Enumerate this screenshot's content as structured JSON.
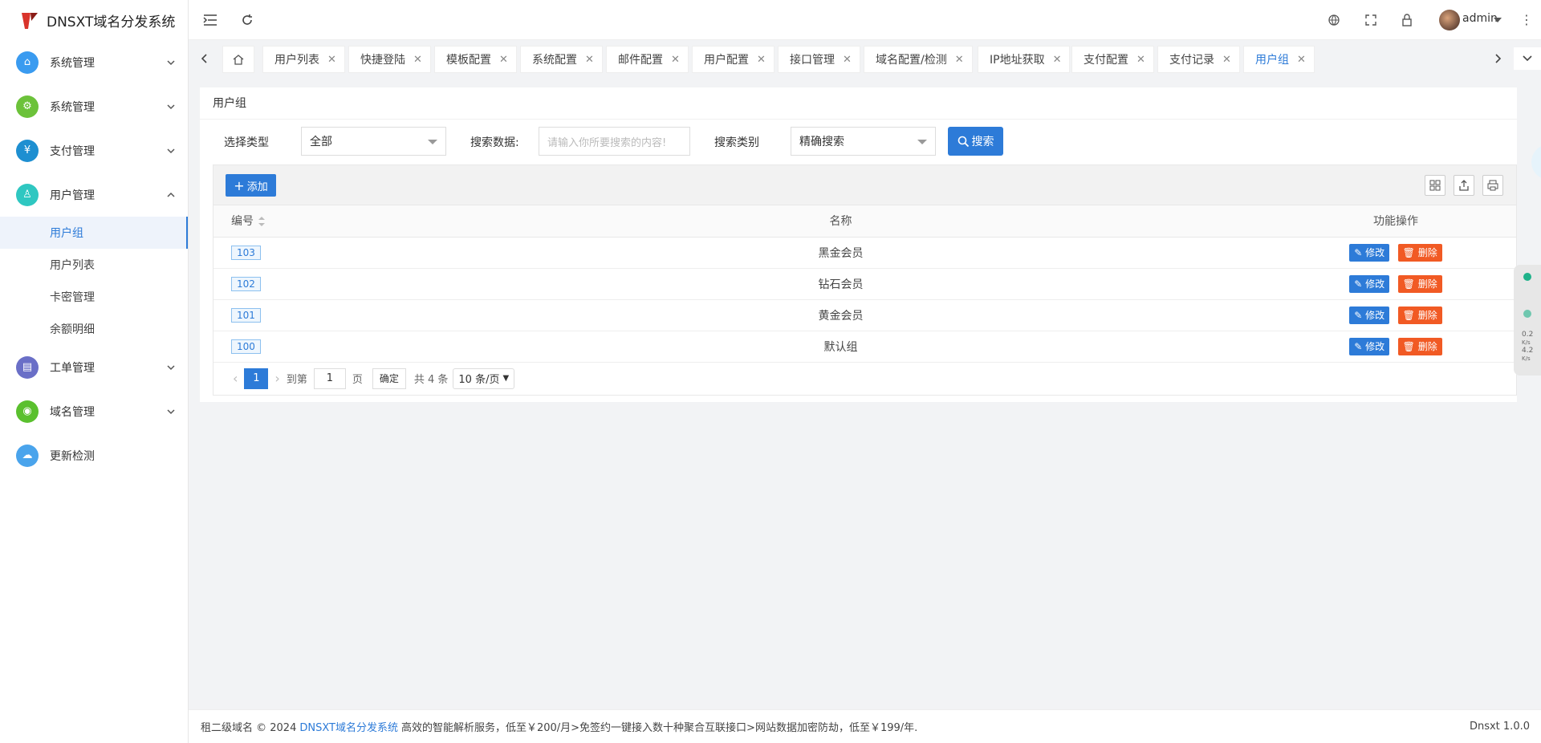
{
  "brand": {
    "title": "DNSXT域名分发系统"
  },
  "sidebar": {
    "items": [
      {
        "label": "系统管理",
        "color": "#3a9bf0",
        "icon": "home-icon"
      },
      {
        "label": "系统管理",
        "color": "#6cc23a",
        "icon": "settings-icon"
      },
      {
        "label": "支付管理",
        "color": "#1e8fd1",
        "icon": "yen-icon"
      },
      {
        "label": "用户管理",
        "color": "#2fc7c1",
        "icon": "user-icon"
      },
      {
        "label": "工单管理",
        "color": "#6a6fc7",
        "icon": "ticket-icon"
      },
      {
        "label": "域名管理",
        "color": "#5ac02e",
        "icon": "domain-icon"
      },
      {
        "label": "更新检测",
        "color": "#4aa4ec",
        "icon": "cloud-upload-icon"
      }
    ],
    "submenu": [
      "用户组",
      "用户列表",
      "卡密管理",
      "余额明细"
    ]
  },
  "header": {
    "user": "admin"
  },
  "tabs": [
    "用户列表",
    "快捷登陆",
    "模板配置",
    "系统配置",
    "邮件配置",
    "用户配置",
    "接口管理",
    "域名配置/检测",
    "IP地址获取",
    "支付配置",
    "支付记录",
    "用户组"
  ],
  "card": {
    "title": "用户组"
  },
  "filter": {
    "type_label": "选择类型",
    "type_value": "全部",
    "data_label": "搜索数据:",
    "data_placeholder": "请输入你所要搜索的内容!",
    "category_label": "搜索类别",
    "category_value": "精确搜索",
    "search_label": "搜索"
  },
  "table": {
    "add_label": "添加",
    "headers": {
      "id": "编号",
      "name": "名称",
      "op": "功能操作"
    },
    "rows": [
      {
        "id": "103",
        "name": "黑金会员"
      },
      {
        "id": "102",
        "name": "钻石会员"
      },
      {
        "id": "101",
        "name": "黄金会员"
      },
      {
        "id": "100",
        "name": "默认组"
      }
    ],
    "edit_label": "修改",
    "delete_label": "删除"
  },
  "pager": {
    "current": "1",
    "goto_label": "到第",
    "goto_value": "1",
    "page_label": "页",
    "confirm_label": "确定",
    "total_label": "共 4 条",
    "size_label": "10 条/页"
  },
  "footer": {
    "prefix": "租二级域名 © 2024",
    "link": "DNSXT域名分发系统",
    "text": "高效的智能解析服务，低至￥200/月>免签约一键接入数十种聚合互联接口>网站数据加密防劫，低至￥199/年.",
    "version": "Dnsxt 1.0.0"
  },
  "monitor": {
    "up": "0.2",
    "up_unit": "K/s",
    "down": "4.2",
    "down_unit": "K/s"
  }
}
